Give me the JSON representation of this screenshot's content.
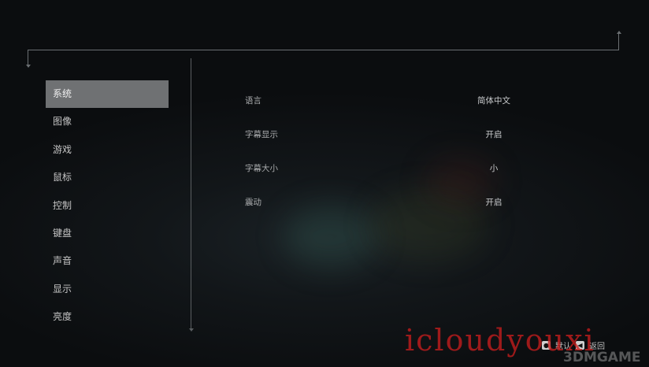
{
  "sidebar": {
    "items": [
      {
        "label": "系统",
        "active": true
      },
      {
        "label": "图像",
        "active": false
      },
      {
        "label": "游戏",
        "active": false
      },
      {
        "label": "鼠标",
        "active": false
      },
      {
        "label": "控制",
        "active": false
      },
      {
        "label": "键盘",
        "active": false
      },
      {
        "label": "声音",
        "active": false
      },
      {
        "label": "显示",
        "active": false
      },
      {
        "label": "亮度",
        "active": false
      }
    ]
  },
  "settings": {
    "rows": [
      {
        "label": "语言",
        "value": "简体中文"
      },
      {
        "label": "字幕显示",
        "value": "开启"
      },
      {
        "label": "字幕大小",
        "value": "小"
      },
      {
        "label": "震动",
        "value": "开启"
      }
    ]
  },
  "footer": {
    "confirm_label": "默认",
    "back_label": "返回"
  },
  "watermark": {
    "text": "icloudyouxi",
    "logo": "3DMGAME"
  },
  "colors": {
    "active_tab_bg": "#6f7173",
    "frame_line": "#6b6f72",
    "watermark_red": "#c81e1e"
  }
}
